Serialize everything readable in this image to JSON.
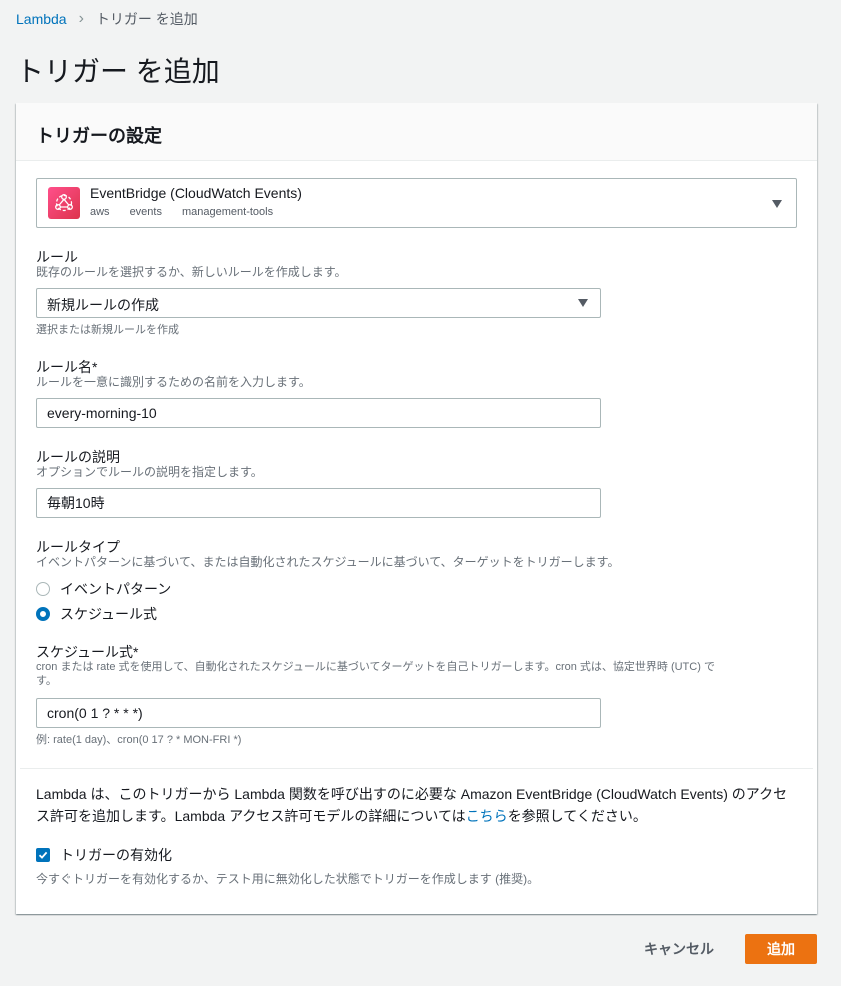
{
  "breadcrumb": {
    "root": "Lambda",
    "current": "トリガー を追加"
  },
  "page_title": "トリガー を追加",
  "panel": {
    "title": "トリガーの設定"
  },
  "source": {
    "name": "EventBridge (CloudWatch Events)",
    "tags": [
      "aws",
      "events",
      "management-tools"
    ],
    "icon": "eventbridge-icon",
    "icon_color": "#dd344c"
  },
  "rule": {
    "label": "ルール",
    "description": "既存のルールを選択するか、新しいルールを作成します。",
    "selected": "新規ルールの作成",
    "hint": "選択または新規ルールを作成"
  },
  "rule_name": {
    "label": "ルール名*",
    "description": "ルールを一意に識別するための名前を入力します。",
    "value": "every-morning-10"
  },
  "rule_description": {
    "label": "ルールの説明",
    "description": "オプションでルールの説明を指定します。",
    "value": "毎朝10時"
  },
  "rule_type": {
    "label": "ルールタイプ",
    "description": "イベントパターンに基づいて、または自動化されたスケジュールに基づいて、ターゲットをトリガーします。",
    "options": [
      "イベントパターン",
      "スケジュール式"
    ],
    "selected": "スケジュール式"
  },
  "schedule": {
    "label": "スケジュール式*",
    "description_line1": "cron または rate 式を使用して、自動化されたスケジュールに基づいてターゲットを自己トリガーします。cron 式は、協定世界時 (UTC) で",
    "description_line2": "す。",
    "value": "cron(0 1 ? * * *)",
    "hint": "例: rate(1 day)、cron(0 17 ? * MON-FRI *)"
  },
  "notice": {
    "line1": "Lambda は、このトリガーから Lambda 関数を呼び出すのに必要な Amazon EventBridge (CloudWatch Events) のアクセ",
    "line2_prefix": "ス許可を追加します。Lambda アクセス許可モデルの詳細については",
    "link": "こちら",
    "line2_suffix": "を参照してください。"
  },
  "enable_trigger": {
    "label": "トリガーの有効化",
    "checked": true,
    "description": "今すぐトリガーを有効化するか、テスト用に無効化した状態でトリガーを作成します (推奨)。"
  },
  "buttons": {
    "cancel": "キャンセル",
    "add": "追加"
  },
  "colors": {
    "accent": "#0073bb",
    "primary_button": "#ec7211"
  }
}
